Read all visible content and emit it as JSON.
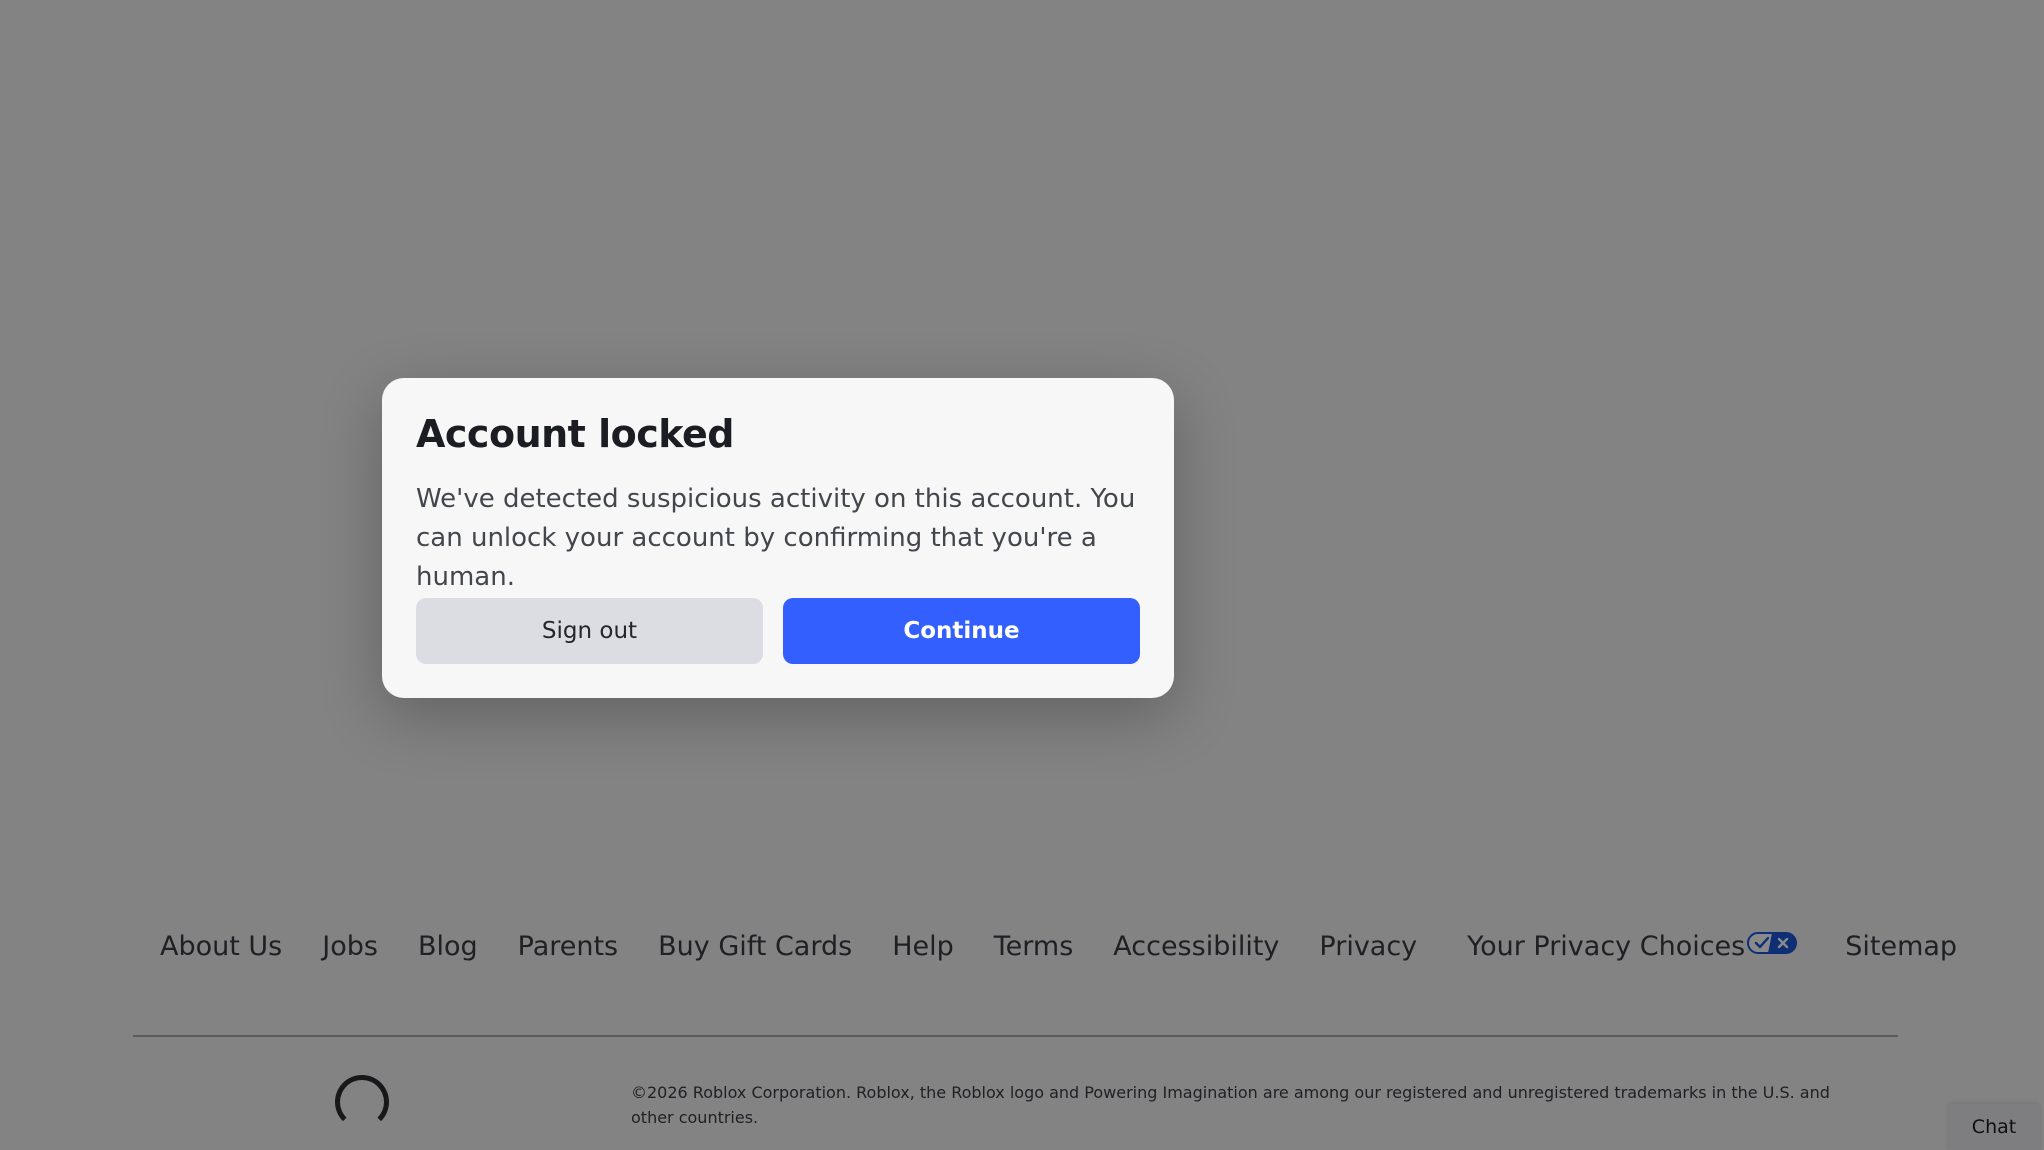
{
  "footer": {
    "links": {
      "about": "About Us",
      "jobs": "Jobs",
      "blog": "Blog",
      "parents": "Parents",
      "gift_cards": "Buy Gift Cards",
      "help": "Help",
      "terms": "Terms",
      "accessibility": "Accessibility",
      "privacy": "Privacy",
      "privacy_choices": "Your Privacy Choices",
      "sitemap": "Sitemap"
    },
    "copyright": "©2026 Roblox Corporation. Roblox, the Roblox logo and Powering Imagination are among our registered and unregistered trademarks in the U.S. and other countries.",
    "privacy_toggle_icon": "privacy-choices-toggle-icon",
    "privacy_toggle_color": "#1a56db"
  },
  "chat": {
    "label": "Chat"
  },
  "modal": {
    "title": "Account locked",
    "body": "We've detected suspicious activity on this account. You can unlock your account by confirming that you're a human.",
    "secondary_button": "Sign out",
    "primary_button": "Continue",
    "primary_color": "#335fff"
  }
}
